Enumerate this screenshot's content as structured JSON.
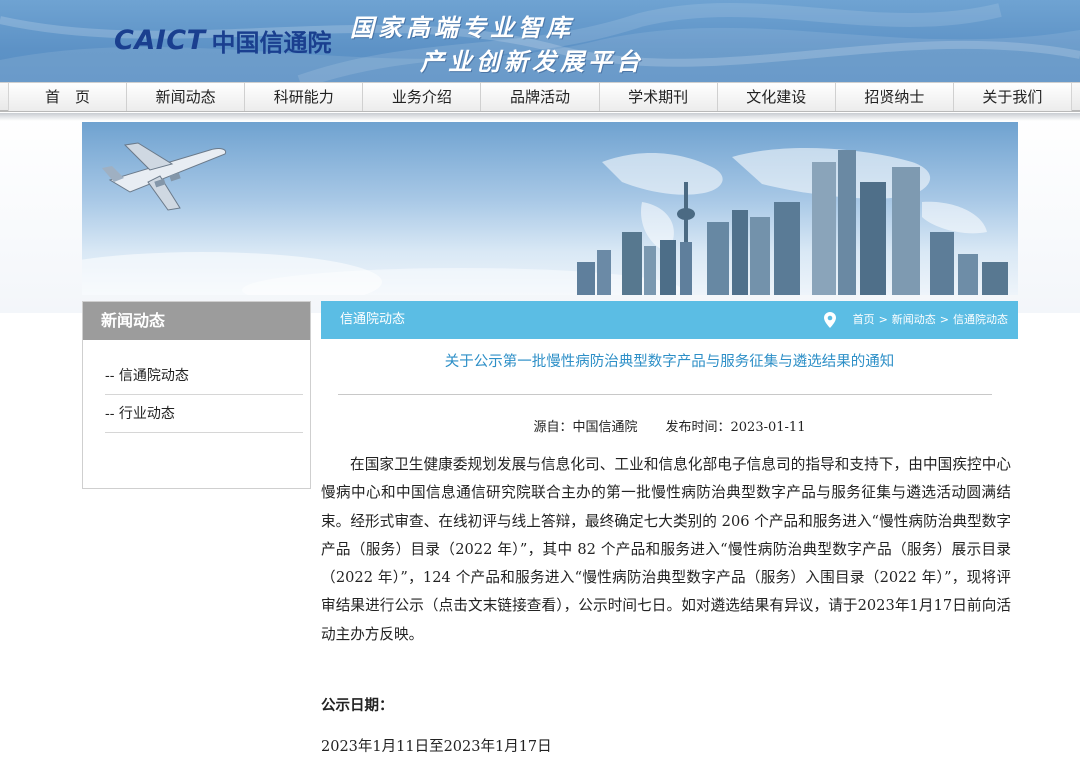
{
  "header": {
    "logo_en": "CAICT",
    "logo_cn": "中国信通院",
    "slogan_line1": "国家高端专业智库",
    "slogan_line2": "产业创新发展平台"
  },
  "nav": {
    "items": [
      "首　页",
      "新闻动态",
      "科研能力",
      "业务介绍",
      "品牌活动",
      "学术期刊",
      "文化建设",
      "招贤纳士",
      "关于我们"
    ]
  },
  "sidebar": {
    "title": "新闻动态",
    "items": [
      "-- 信通院动态",
      "-- 行业动态"
    ]
  },
  "main": {
    "section_title": "信通院动态",
    "breadcrumb": {
      "home": "首页",
      "sep": ">",
      "level1": "新闻动态",
      "level2": "信通院动态"
    },
    "article": {
      "title": "关于公示第一批慢性病防治典型数字产品与服务征集与遴选结果的通知",
      "source_label": "源自：中国信通院",
      "date_label": "发布时间：2023-01-11",
      "body": "在国家卫生健康委规划发展与信息化司、工业和信息化部电子信息司的指导和支持下，由中国疾控中心慢病中心和中国信息通信研究院联合主办的第一批慢性病防治典型数字产品与服务征集与遴选活动圆满结束。经形式审查、在线初评与线上答辩，最终确定七大类别的 206 个产品和服务进入“慢性病防治典型数字产品（服务）目录（2022 年）”，其中 82 个产品和服务进入“慢性病防治典型数字产品（服务）展示目录（2022 年）”，124 个产品和服务进入“慢性病防治典型数字产品（服务）入围目录（2022 年）”，现将评审结果进行公示（点击文末链接查看），公示时间七日。如对遴选结果有异议，请于2023年1月17日前向活动主办方反映。",
      "publicity_label": "公示日期：",
      "publicity_range": "2023年1月11日至2023年1月17日"
    }
  },
  "colors": {
    "header_blue": "#5d92c6",
    "logo_blue": "#1a3f8f",
    "section_bar": "#5bbde4",
    "title_blue": "#2d8fc7",
    "sidebar_head": "#9c9c9c"
  },
  "icons": {
    "breadcrumb_icon": "location-pin-icon",
    "banner_airplane": "airplane-icon"
  }
}
